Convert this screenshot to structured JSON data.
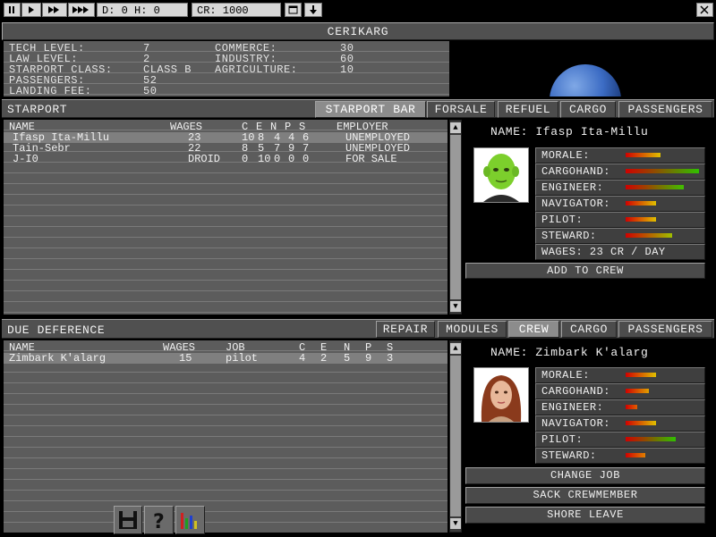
{
  "toolbar": {
    "date_time": "D: 0 H: 0",
    "credits": "CR: 1000"
  },
  "planet": {
    "name": "CERIKARG",
    "stats_left": [
      {
        "label": "TECH LEVEL:",
        "value": "7"
      },
      {
        "label": "LAW LEVEL:",
        "value": "2"
      },
      {
        "label": "STARPORT CLASS:",
        "value": "CLASS B"
      },
      {
        "label": "PASSENGERS:",
        "value": "52"
      },
      {
        "label": "LANDING FEE:",
        "value": "50"
      }
    ],
    "stats_right": [
      {
        "label": "COMMERCE:",
        "value": "30"
      },
      {
        "label": "INDUSTRY:",
        "value": "60"
      },
      {
        "label": "AGRICULTURE:",
        "value": "10"
      }
    ]
  },
  "starport": {
    "title": "STARPORT",
    "tabs": [
      "STARPORT BAR",
      "FORSALE",
      "REFUEL",
      "CARGO",
      "PASSENGERS"
    ],
    "active_tab": 0,
    "columns": {
      "name": "NAME",
      "wages": "WAGES",
      "c": "C",
      "e": "E",
      "n": "N",
      "p": "P",
      "s": "S",
      "employer": "EMPLOYER"
    },
    "rows": [
      {
        "name": "Ifasp Ita-Millu",
        "wages": "23",
        "c": "10",
        "e": "8",
        "n": "4",
        "p": "4",
        "s": "6",
        "employer": "UNEMPLOYED"
      },
      {
        "name": "Tain-Sebr",
        "wages": "22",
        "c": "8",
        "e": "5",
        "n": "7",
        "p": "9",
        "s": "7",
        "employer": "UNEMPLOYED"
      },
      {
        "name": "J-I0",
        "wages": "DROID",
        "c": "0",
        "e": "10",
        "n": "0",
        "p": "0",
        "s": "0",
        "employer": "FOR SALE"
      }
    ],
    "selected": {
      "name_line": "NAME: Ifasp Ita-Millu",
      "skills": [
        {
          "label": "MORALE:",
          "level": 0.45,
          "colors": [
            "#d00000",
            "#e0c000"
          ]
        },
        {
          "label": "CARGOHAND:",
          "level": 0.95,
          "colors": [
            "#d00000",
            "#30c000"
          ]
        },
        {
          "label": "ENGINEER:",
          "level": 0.75,
          "colors": [
            "#d00000",
            "#40c000"
          ]
        },
        {
          "label": "NAVIGATOR:",
          "level": 0.4,
          "colors": [
            "#d00000",
            "#e0c000"
          ]
        },
        {
          "label": "PILOT:",
          "level": 0.4,
          "colors": [
            "#d00000",
            "#e0c000"
          ]
        },
        {
          "label": "STEWARD:",
          "level": 0.6,
          "colors": [
            "#d00000",
            "#a0c000"
          ]
        }
      ],
      "wages_line": "WAGES: 23 CR / DAY",
      "add_button": "ADD TO CREW"
    }
  },
  "ship": {
    "title": "DUE DEFERENCE",
    "tabs": [
      "REPAIR",
      "MODULES",
      "CREW",
      "CARGO",
      "PASSENGERS"
    ],
    "active_tab": 2,
    "columns": {
      "name": "NAME",
      "wages": "WAGES",
      "job": "JOB",
      "c": "C",
      "e": "E",
      "n": "N",
      "p": "P",
      "s": "S"
    },
    "rows": [
      {
        "name": "Zimbark K'alarg",
        "wages": "15",
        "job": "pilot",
        "c": "4",
        "e": "2",
        "n": "5",
        "p": "9",
        "s": "3"
      }
    ],
    "selected": {
      "name_line": "NAME: Zimbark K'alarg",
      "skills": [
        {
          "label": "MORALE:",
          "level": 0.4,
          "colors": [
            "#d00000",
            "#e0c000"
          ]
        },
        {
          "label": "CARGOHAND:",
          "level": 0.3,
          "colors": [
            "#d00000",
            "#e0a000"
          ]
        },
        {
          "label": "ENGINEER:",
          "level": 0.15,
          "colors": [
            "#d00000",
            "#e06000"
          ]
        },
        {
          "label": "NAVIGATOR:",
          "level": 0.4,
          "colors": [
            "#d00000",
            "#e0c000"
          ]
        },
        {
          "label": "PILOT:",
          "level": 0.65,
          "colors": [
            "#d00000",
            "#30c000"
          ]
        },
        {
          "label": "STEWARD:",
          "level": 0.25,
          "colors": [
            "#d00000",
            "#e08000"
          ]
        }
      ],
      "buttons": [
        "CHANGE JOB",
        "SACK CREWMEMBER",
        "SHORE LEAVE"
      ]
    }
  },
  "icons": [
    "pause-icon",
    "play-icon",
    "fast-forward-icon",
    "fastest-forward-icon",
    "window-icon",
    "download-arrow-icon",
    "close-icon",
    "save-disk-icon",
    "help-icon",
    "stats-chart-icon"
  ]
}
